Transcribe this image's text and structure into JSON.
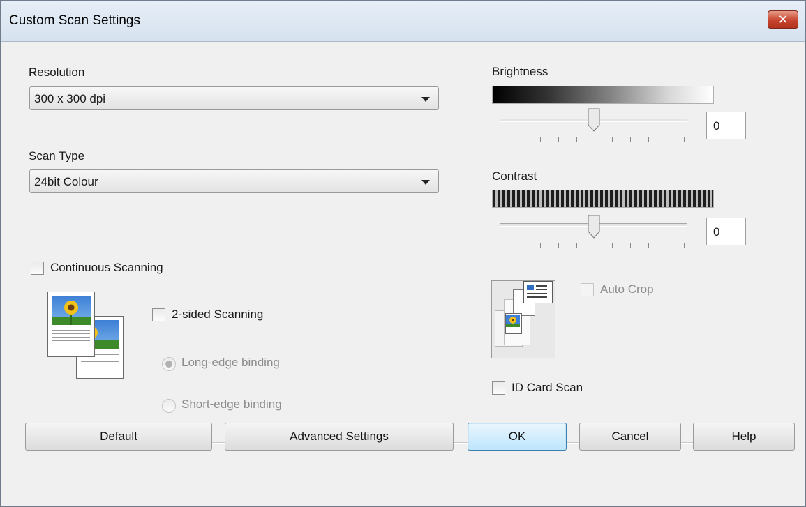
{
  "window": {
    "title": "Custom Scan Settings",
    "close_glyph": "✕"
  },
  "resolution": {
    "label": "Resolution",
    "value": "300 x 300 dpi"
  },
  "scan_type": {
    "label": "Scan Type",
    "value": "24bit Colour"
  },
  "brightness": {
    "label": "Brightness",
    "value": "0",
    "slider_fraction": 0.5
  },
  "contrast": {
    "label": "Contrast",
    "value": "0",
    "slider_fraction": 0.5
  },
  "continuous_scanning": {
    "label": "Continuous Scanning",
    "checked": false
  },
  "two_sided": {
    "label": "2-sided Scanning",
    "checked": false
  },
  "binding": {
    "long_edge": {
      "label": "Long-edge binding",
      "selected": true,
      "enabled": false
    },
    "short_edge": {
      "label": "Short-edge binding",
      "selected": false,
      "enabled": false
    }
  },
  "auto_crop": {
    "label": "Auto Crop",
    "checked": false,
    "enabled": false
  },
  "id_card_scan": {
    "label": "ID Card Scan",
    "checked": false
  },
  "buttons": {
    "default": "Default",
    "advanced": "Advanced Settings",
    "ok": "OK",
    "cancel": "Cancel",
    "help": "Help"
  },
  "colors": {
    "titlebar": "#dbe6f2",
    "close_button": "#c7442e",
    "ok_border": "#3c7fb1"
  }
}
